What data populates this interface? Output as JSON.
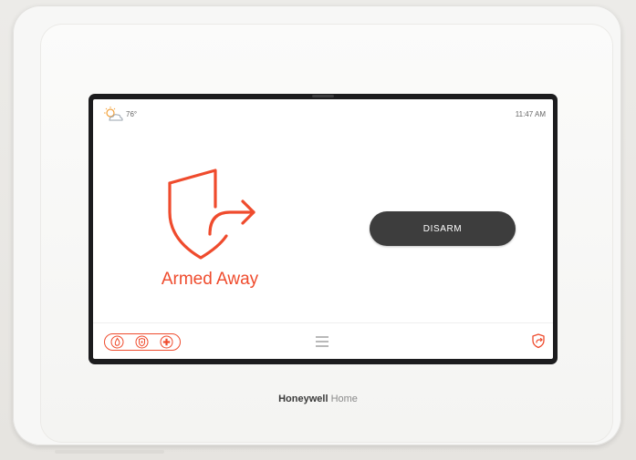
{
  "status": {
    "weather_icon": "partly-sunny-icon",
    "temperature": "76°",
    "time": "11:47 AM"
  },
  "security": {
    "state_label": "Armed Away",
    "state_icon": "shield-arrow-icon",
    "disarm_label": "DISARM"
  },
  "bottom_bar": {
    "emergency_icons": [
      "fire-icon",
      "police-icon",
      "medical-icon"
    ],
    "menu_icon": "hamburger-menu-icon",
    "mode_icon": "shield-arrow-icon"
  },
  "brand": {
    "name_bold": "Honeywell",
    "name_light": "Home"
  },
  "colors": {
    "accent": "#ef4b2d",
    "button": "#3d3d3d"
  }
}
